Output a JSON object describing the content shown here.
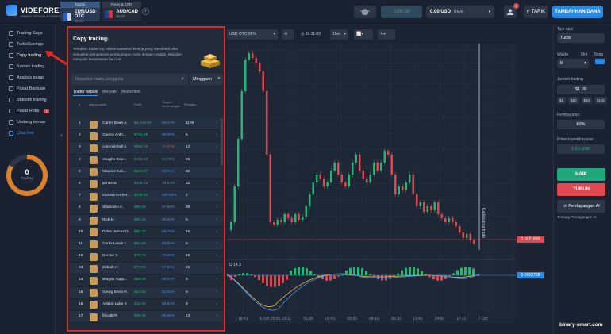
{
  "brand": {
    "name": "VIDEFOREX",
    "tagline": "BINARY OPTION & FOREX TRADING"
  },
  "asset_tabs": [
    {
      "header": "Digital",
      "name": "EUR/USD OTC",
      "pct": "95.00"
    },
    {
      "header": "Forex & CFD",
      "name": "AUD/CAD",
      "pct": "80.00"
    }
  ],
  "header": {
    "plus": "+",
    "balance_placeholder": "1000.00",
    "balance": "0.00 USD",
    "balance_mode": "REAL",
    "notif_count": "3",
    "withdraw": "TARIK",
    "deposit": "TAMBAHKAN DANA"
  },
  "sidebar": {
    "items": [
      {
        "label": "Trading Saya"
      },
      {
        "label": "TurboSavings"
      },
      {
        "label": "Copy trading"
      },
      {
        "label": "Kontes trading"
      },
      {
        "label": "Analisis pasar"
      },
      {
        "label": "Pusat Bantuan"
      },
      {
        "label": "Statistik trading"
      },
      {
        "label": "Pasar Roks",
        "badge": "1"
      },
      {
        "label": "Undang teman"
      },
      {
        "label": "Chat live"
      }
    ],
    "ring_count": "0",
    "ring_label": "Trading"
  },
  "panel": {
    "title": "Copy trading",
    "desc": "Temukan trader top, akses wawasan kinerja yang mendetail, dan sesuaikan pengaturan perdagangan Anda dengan mudah. Mulailah menyalin kesuksesan hari ini!",
    "search_placeholder": "Masukkan nama pengguna",
    "period": "Mingguan",
    "tabs": [
      "Trader terbaik",
      "Menyalin",
      "Memonton"
    ],
    "col_no": "#",
    "col_name": "Nama trader",
    "col_profit": "Profit",
    "col_rate": "Tingkat kemenangan",
    "col_copiers": "Penyalin"
  },
  "traders": [
    {
      "no": "1",
      "name": "Carter Dean A.",
      "profit": "$2,042.84",
      "rate": "48.47%",
      "copiers": "1176",
      "neg": false
    },
    {
      "no": "2",
      "name": "Quincy Anth...",
      "profit": "$724.49",
      "rate": "50.00%",
      "copiers": "6",
      "neg": false
    },
    {
      "no": "3",
      "name": "cole mitchell k.",
      "profit": "$654.23",
      "rate": "41.67%",
      "copiers": "12",
      "neg": true
    },
    {
      "no": "4",
      "name": "Vaughn Bran...",
      "profit": "$415.95",
      "rate": "61.76%",
      "copiers": "68",
      "neg": false
    },
    {
      "no": "5",
      "name": "Maurice Kek...",
      "profit": "$150.07",
      "rate": "46.67%",
      "copiers": "30",
      "neg": false
    },
    {
      "no": "6",
      "name": "james w.",
      "profit": "$149.12",
      "rate": "78.13%",
      "copiers": "32",
      "neg": false
    },
    {
      "no": "7",
      "name": "KENNETH SH...",
      "profit": "$138.10",
      "rate": "100.00%",
      "copiers": "2",
      "neg": false
    },
    {
      "no": "8",
      "name": "Shahrukh A.",
      "profit": "$99.58",
      "rate": "57.58%",
      "copiers": "99",
      "neg": false
    },
    {
      "no": "9",
      "name": "Rick M.",
      "profit": "$96.32",
      "rate": "80.00%",
      "copiers": "5",
      "neg": false
    },
    {
      "no": "10",
      "name": "Dylan James D.",
      "profit": "$85.23",
      "rate": "68.75%",
      "copiers": "16",
      "neg": false
    },
    {
      "no": "11",
      "name": "Curtis Lewis c.",
      "profit": "$84.88",
      "rate": "66.67%",
      "copiers": "6",
      "neg": false
    },
    {
      "no": "12",
      "name": "Denise V.",
      "profit": "$76.76",
      "rate": "72.22%",
      "copiers": "18",
      "neg": false
    },
    {
      "no": "13",
      "name": "Zobaib H.",
      "profit": "$76.63",
      "rate": "57.89%",
      "copiers": "19",
      "neg": false
    },
    {
      "no": "14",
      "name": "Brayan Augu...",
      "profit": "$68.08",
      "rate": "66.67%",
      "copiers": "6",
      "neg": false
    },
    {
      "no": "15",
      "name": "Georg Ernst H.",
      "profit": "$53.92",
      "rate": "62.50%",
      "copiers": "8",
      "neg": false
    },
    {
      "no": "16",
      "name": "Avalon Luke V.",
      "profit": "$42.00",
      "rate": "88.89%",
      "copiers": "9",
      "neg": false
    },
    {
      "no": "17",
      "name": "fiscal876",
      "profit": "$39.38",
      "rate": "65.28%",
      "copiers": "13",
      "neg": false
    }
  ],
  "chart": {
    "pair": "USD OTC 95%",
    "clock": "16:11:03",
    "timeframe": "15m",
    "price_levels": [
      "1.1350000",
      "1.1300000",
      "1.1250000",
      "1.1200000",
      "1.1150000",
      "1.1100000",
      "1.1050000",
      "1.1000000",
      "1.0950000",
      "1.0900000",
      "1.0850000"
    ],
    "current_price": "1.0921890",
    "indicator_label": "D 14.3",
    "indicator_value": "0.0003758",
    "indicator_levels": [
      "0.0000000",
      "-0.0047500"
    ],
    "time_labels": [
      "18:41",
      "6 Oct 20:56",
      "23:11",
      "01:26",
      "03:41",
      "05:56",
      "08:11",
      "10:26",
      "12:41",
      "14:56",
      "17:11",
      "7 Oct"
    ],
    "expiry_label": "Kadaluarsa trade"
  },
  "right": {
    "option_type_label": "Tipe opsi",
    "option_type": "Turbo",
    "time_label": "Waktu",
    "time_unit1": "Mnt",
    "time_unit2": "Tetap",
    "time_value": "5",
    "amount_label": "Jumlah trading",
    "amount": "$1.00",
    "quick_amounts": [
      "$1",
      "$10",
      "$50",
      "$100"
    ],
    "payout_label": "Pembayaran",
    "payout": "60%",
    "potential_label": "Potensi pembayaran",
    "potential": "1.60 USD",
    "buy": "NAIK",
    "sell": "TURUN",
    "ai_button": "Perdagangan AI",
    "ai_about": "Tentang Perdagangan AI"
  },
  "watermark": "binary-smart.com"
}
